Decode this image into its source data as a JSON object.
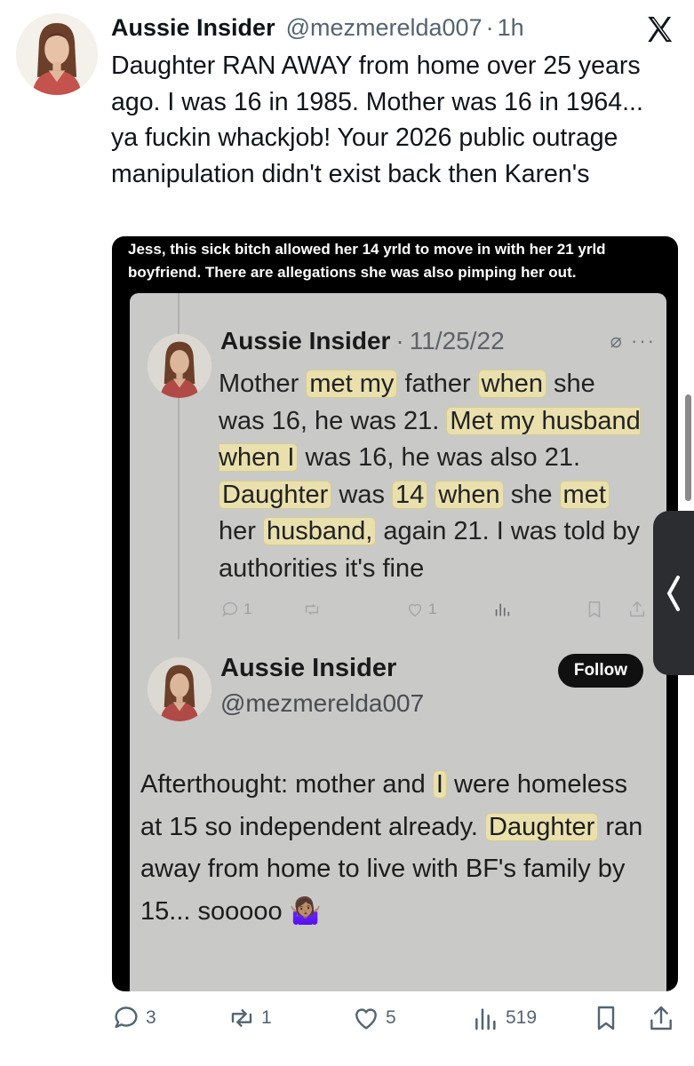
{
  "tweet": {
    "author_name": "Aussie Insider",
    "handle": "@mezmerelda007",
    "separator": "·",
    "time": "1h",
    "text": "Daughter RAN AWAY from home over 25 years ago. I was 16 in 1985. Mother was 16 in 1964... ya fuckin whackjob! Your 2026 public outrage manipulation didn't exist back then Karen's"
  },
  "media": {
    "caption": "Jess, this sick bitch allowed her 14 yrld to move in with her 21 yrld boyfriend. There are allegations she was also pimping her out.",
    "quoted_post": {
      "author_name": "Aussie Insider",
      "separator": "·",
      "date": "11/25/22",
      "icons": "⌀ ···",
      "body_segments": [
        {
          "t": "Mother ",
          "h": false
        },
        {
          "t": "met my",
          "h": true
        },
        {
          "t": " father ",
          "h": false
        },
        {
          "t": "when",
          "h": true
        },
        {
          "t": " she was 16, he was 21. ",
          "h": false
        },
        {
          "t": "Met my husband when I",
          "h": true
        },
        {
          "t": " was 16, he was also 21. ",
          "h": false
        },
        {
          "t": "Daughter",
          "h": true
        },
        {
          "t": " was ",
          "h": false
        },
        {
          "t": "14",
          "h": true
        },
        {
          "t": " ",
          "h": false
        },
        {
          "t": "when",
          "h": true
        },
        {
          "t": " she ",
          "h": false
        },
        {
          "t": "met",
          "h": true
        },
        {
          "t": " her ",
          "h": false
        },
        {
          "t": "husband,",
          "h": true
        },
        {
          "t": " again 21. I was told by authorities it's fine",
          "h": false
        }
      ],
      "actions": {
        "reply_count": "1",
        "like_count": "1"
      }
    },
    "second_post": {
      "author_name": "Aussie Insider",
      "handle": "@mezmerelda007",
      "follow_label": "Follow",
      "body_segments": [
        {
          "t": "Afterthought: mother and ",
          "h": false
        },
        {
          "t": "I",
          "h": true
        },
        {
          "t": " were homeless at 15 so independent already. ",
          "h": false
        },
        {
          "t": "Daughter",
          "h": true
        },
        {
          "t": " ran away from home to live with BF's family by 15... sooooo 🤷🏽‍♀️",
          "h": false
        }
      ]
    }
  },
  "actions": {
    "reply_count": "3",
    "repost_count": "1",
    "like_count": "5",
    "views_count": "519"
  },
  "icons": {
    "logo": "x-logo-icon",
    "reply": "reply-icon",
    "repost": "repost-icon",
    "like": "heart-icon",
    "views": "views-icon",
    "bookmark": "bookmark-icon",
    "share": "share-icon",
    "side_tab": "chevron-left-icon"
  },
  "colors": {
    "text": "#0f1419",
    "secondary": "#536471",
    "highlight": "#e9e0ad",
    "screenshot_bg": "#c9c9c8"
  }
}
